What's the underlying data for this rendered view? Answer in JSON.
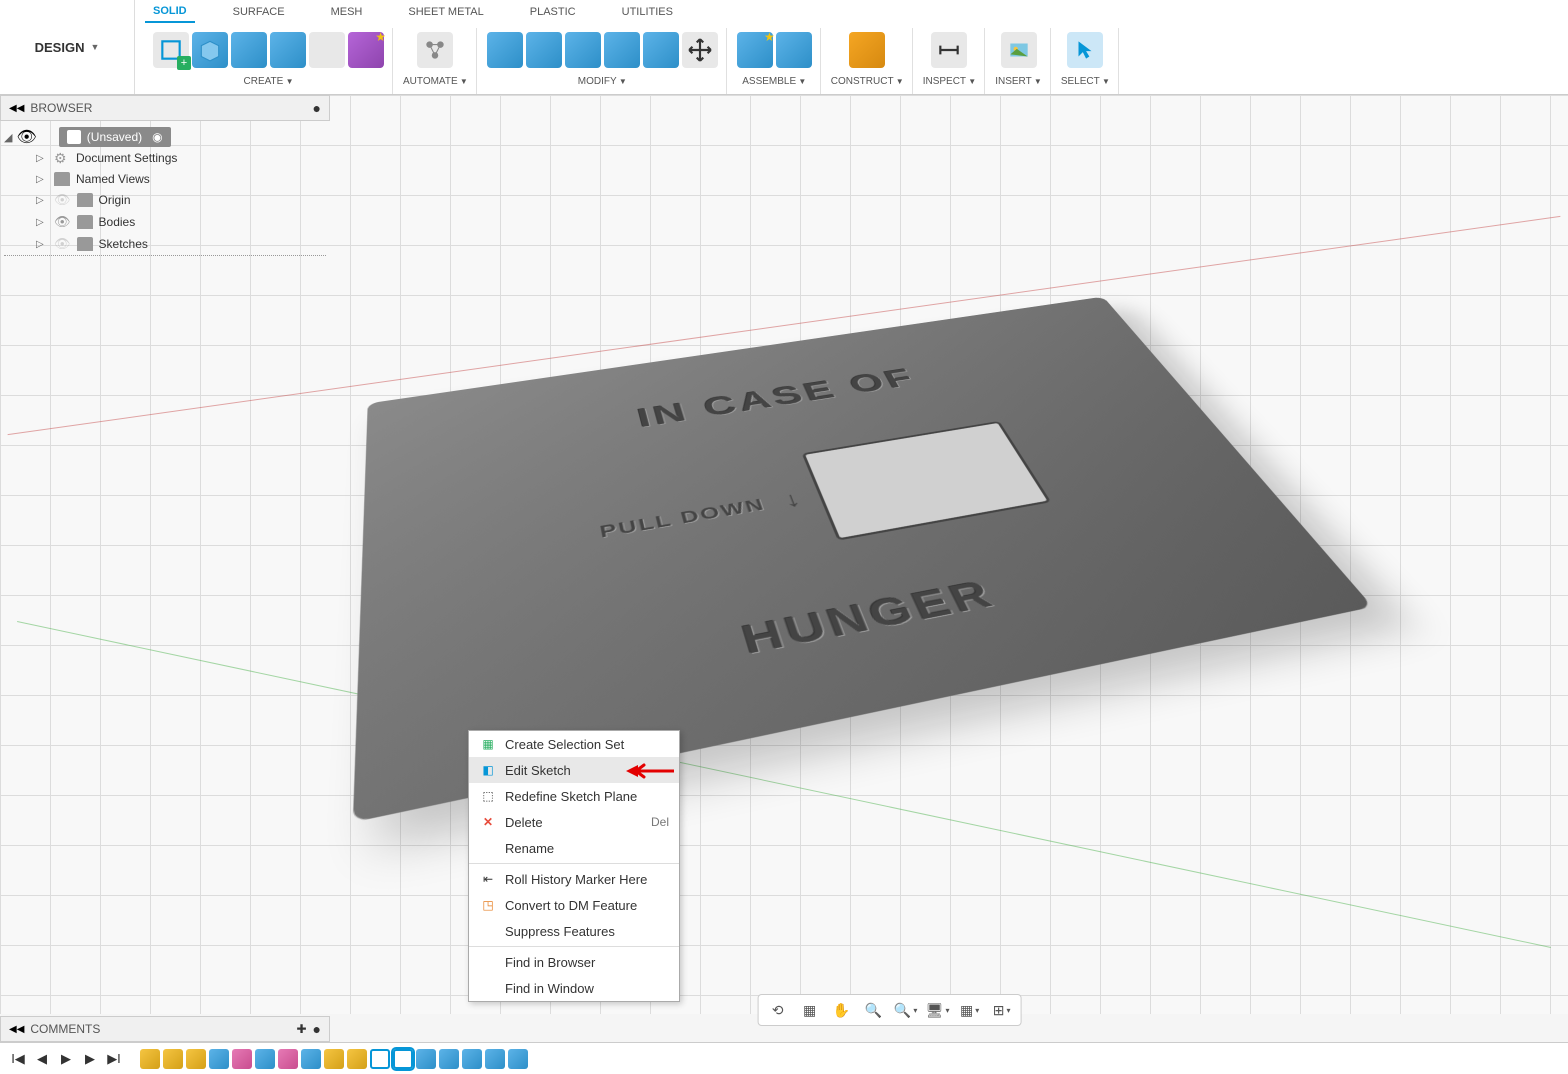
{
  "design_button": "DESIGN",
  "tabs": {
    "solid": "SOLID",
    "surface": "SURFACE",
    "mesh": "MESH",
    "sheet_metal": "SHEET METAL",
    "plastic": "PLASTIC",
    "utilities": "UTILITIES"
  },
  "toolbar_groups": {
    "create": "CREATE",
    "automate": "AUTOMATE",
    "modify": "MODIFY",
    "assemble": "ASSEMBLE",
    "construct": "CONSTRUCT",
    "inspect": "INSPECT",
    "insert": "INSERT",
    "select": "SELECT"
  },
  "browser": {
    "title": "BROWSER",
    "root": "(Unsaved)",
    "items": {
      "doc_settings": "Document Settings",
      "named_views": "Named Views",
      "origin": "Origin",
      "bodies": "Bodies",
      "sketches": "Sketches"
    }
  },
  "model_text": {
    "top": "IN CASE OF",
    "pull": "PULL DOWN",
    "bottom": "HUNGER"
  },
  "context_menu": {
    "create_selection_set": "Create Selection Set",
    "edit_sketch": "Edit Sketch",
    "redefine_sketch_plane": "Redefine Sketch Plane",
    "delete": "Delete",
    "delete_shortcut": "Del",
    "rename": "Rename",
    "roll_history": "Roll History Marker Here",
    "convert_dm": "Convert to DM Feature",
    "suppress_features": "Suppress Features",
    "find_in_browser": "Find in Browser",
    "find_in_window": "Find in Window"
  },
  "comments_label": "COMMENTS"
}
